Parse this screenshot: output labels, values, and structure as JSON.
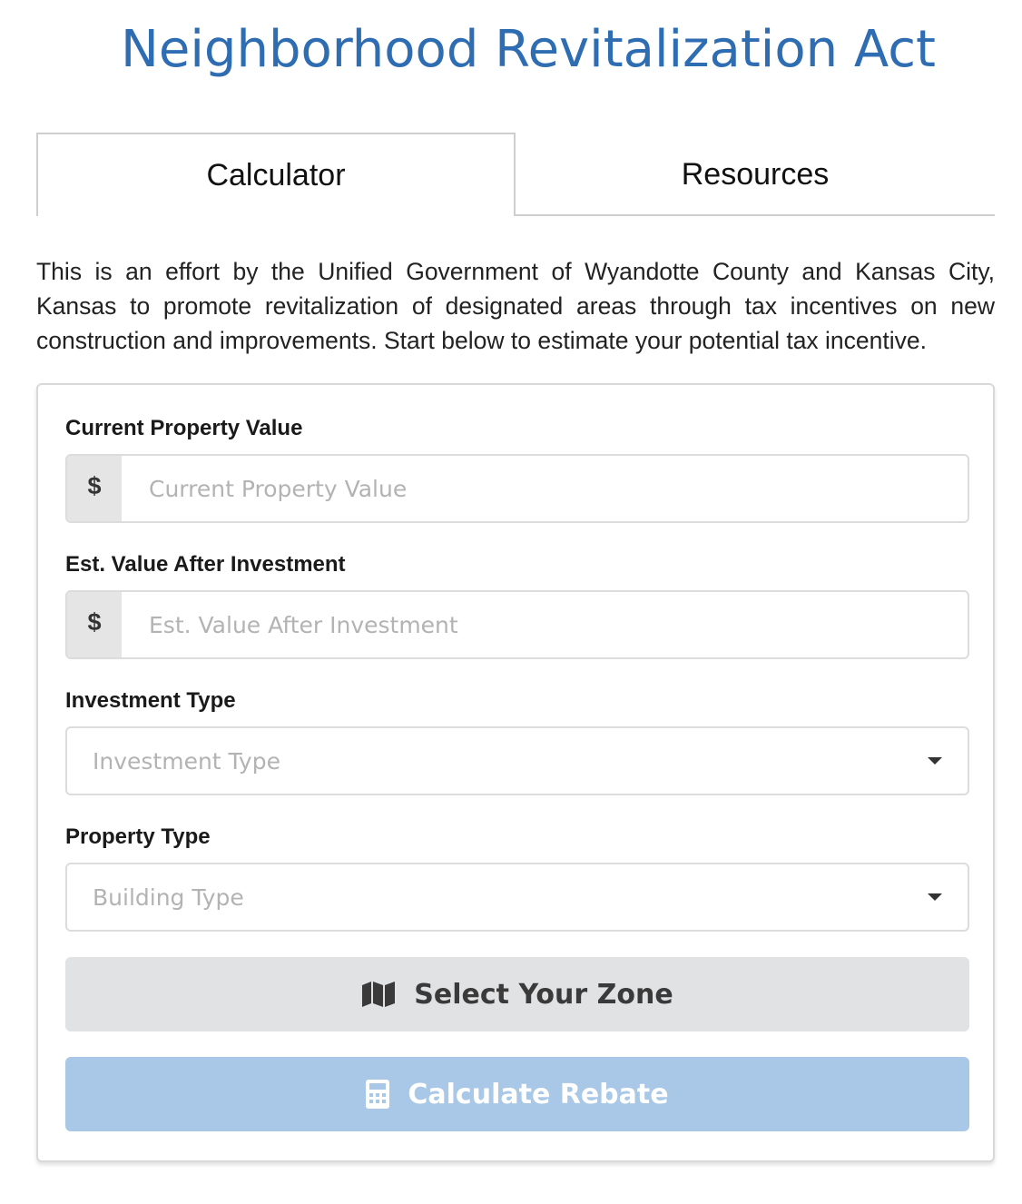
{
  "header": {
    "title": "Neighborhood Revitalization Act"
  },
  "tabs": [
    {
      "label": "Calculator",
      "active": true
    },
    {
      "label": "Resources",
      "active": false
    }
  ],
  "intro": {
    "text": "This is an effort by the Unified Government of Wyandotte County and Kansas City, Kansas to promote revitalization of designated areas through tax incentives on new construction and improvements. Start below to estimate your potential tax incentive."
  },
  "form": {
    "current_value": {
      "label": "Current Property Value",
      "addon": "$",
      "placeholder": "Current Property Value",
      "value": ""
    },
    "after_value": {
      "label": "Est. Value After Investment",
      "addon": "$",
      "placeholder": "Est. Value After Investment",
      "value": ""
    },
    "investment_type": {
      "label": "Investment Type",
      "placeholder": "Investment Type"
    },
    "property_type": {
      "label": "Property Type",
      "placeholder": "Building Type"
    },
    "zone_button": {
      "label": "Select Your Zone",
      "icon": "map-icon"
    },
    "calculate_button": {
      "label": "Calculate Rebate",
      "icon": "calculator-icon",
      "disabled": true
    }
  },
  "colors": {
    "title": "#2f6db3",
    "zone_button_bg": "#e1e2e4",
    "calculate_button_bg": "#a9c7e6",
    "addon_bg": "#e5e5e5",
    "border": "#dcdcdc"
  }
}
